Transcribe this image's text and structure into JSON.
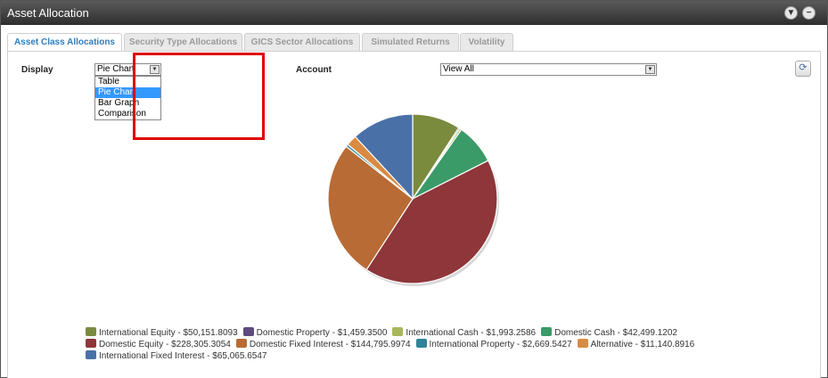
{
  "window": {
    "title": "Asset Allocation"
  },
  "tabs": [
    {
      "label": "Asset Class Allocations",
      "active": true
    },
    {
      "label": "Security Type Allocations",
      "active": false
    },
    {
      "label": "GICS Sector Allocations",
      "active": false
    },
    {
      "label": "Simulated Returns",
      "active": false
    },
    {
      "label": "Volatility",
      "active": false
    }
  ],
  "display": {
    "label": "Display",
    "selected": "Pie Chart",
    "options": [
      "Table",
      "Pie Chart",
      "Bar Graph",
      "Comparison"
    ]
  },
  "account": {
    "label": "Account",
    "selected": "View All"
  },
  "icons": {
    "collapse": "chevron-down-icon",
    "minimize": "minus-icon",
    "refresh": "refresh-icon"
  },
  "chart_data": {
    "type": "pie",
    "series": [
      {
        "name": "International Equity",
        "value": 50151.8093,
        "color": "#7b8b3e",
        "label": "International Equity - $50,151.8093"
      },
      {
        "name": "Domestic Property",
        "value": 1459.35,
        "color": "#5e4a7e",
        "label": "Domestic Property - $1,459.3500"
      },
      {
        "name": "International Cash",
        "value": 1993.2586,
        "color": "#a8b75a",
        "label": "International Cash - $1,993.2586"
      },
      {
        "name": "Domestic Cash",
        "value": 42499.1202,
        "color": "#3a9a68",
        "label": "Domestic Cash - $42,499.1202"
      },
      {
        "name": "Domestic Equity",
        "value": 228305.3054,
        "color": "#8e363a",
        "label": "Domestic Equity - $228,305.3054"
      },
      {
        "name": "Domestic Fixed Interest",
        "value": 144795.9974,
        "color": "#b86b34",
        "label": "Domestic Fixed Interest - $144,795.9974"
      },
      {
        "name": "International Property",
        "value": 2669.5427,
        "color": "#2f8597",
        "label": "International Property - $2,669.5427"
      },
      {
        "name": "Alternative",
        "value": 11140.8916,
        "color": "#d98a43",
        "label": "Alternative - $11,140.8916"
      },
      {
        "name": "International Fixed Interest",
        "value": 65065.6547,
        "color": "#4a70a8",
        "label": "International Fixed Interest - $65,065.6547"
      }
    ]
  }
}
